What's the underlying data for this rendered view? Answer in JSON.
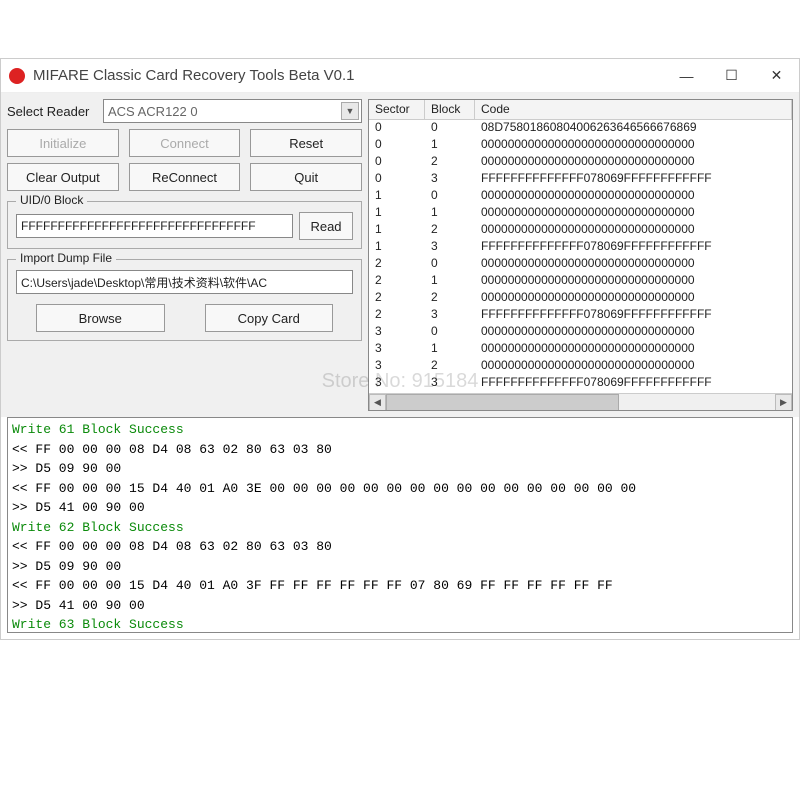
{
  "window": {
    "title": "MIFARE Classic Card Recovery Tools Beta V0.1"
  },
  "labels": {
    "select_reader": "Select Reader",
    "uid_block": "UID/0 Block",
    "import_dump": "Import Dump File"
  },
  "reader": {
    "selected": "ACS ACR122 0"
  },
  "buttons": {
    "initialize": "Initialize",
    "connect": "Connect",
    "reset": "Reset",
    "clear_output": "Clear Output",
    "reconnect": "ReConnect",
    "quit": "Quit",
    "read": "Read",
    "browse": "Browse",
    "copy_card": "Copy Card"
  },
  "uid": {
    "value": "FFFFFFFFFFFFFFFFFFFFFFFFFFFFFFFF"
  },
  "dump": {
    "path": "C:\\Users\\jade\\Desktop\\常用\\技术资料\\软件\\AC"
  },
  "table": {
    "headers": {
      "sector": "Sector",
      "block": "Block",
      "code": "Code"
    },
    "rows": [
      {
        "s": "0",
        "b": "0",
        "c": "08D75801860804006263646566676869"
      },
      {
        "s": "0",
        "b": "1",
        "c": "00000000000000000000000000000000"
      },
      {
        "s": "0",
        "b": "2",
        "c": "00000000000000000000000000000000"
      },
      {
        "s": "0",
        "b": "3",
        "c": "FFFFFFFFFFFFFF078069FFFFFFFFFFFF"
      },
      {
        "s": "1",
        "b": "0",
        "c": "00000000000000000000000000000000"
      },
      {
        "s": "1",
        "b": "1",
        "c": "00000000000000000000000000000000"
      },
      {
        "s": "1",
        "b": "2",
        "c": "00000000000000000000000000000000"
      },
      {
        "s": "1",
        "b": "3",
        "c": "FFFFFFFFFFFFFF078069FFFFFFFFFFFF"
      },
      {
        "s": "2",
        "b": "0",
        "c": "00000000000000000000000000000000"
      },
      {
        "s": "2",
        "b": "1",
        "c": "00000000000000000000000000000000"
      },
      {
        "s": "2",
        "b": "2",
        "c": "00000000000000000000000000000000"
      },
      {
        "s": "2",
        "b": "3",
        "c": "FFFFFFFFFFFFFF078069FFFFFFFFFFFF"
      },
      {
        "s": "3",
        "b": "0",
        "c": "00000000000000000000000000000000"
      },
      {
        "s": "3",
        "b": "1",
        "c": "00000000000000000000000000000000"
      },
      {
        "s": "3",
        "b": "2",
        "c": "00000000000000000000000000000000"
      },
      {
        "s": "3",
        "b": "3",
        "c": "FFFFFFFFFFFFFF078069FFFFFFFFFFFF"
      }
    ]
  },
  "log": [
    {
      "cls": "green",
      "t": "Write 61 Block Success"
    },
    {
      "cls": "black",
      "t": "<< FF 00 00 00 08 D4 08 63 02 80 63 03 80"
    },
    {
      "cls": "black",
      "t": ">> D5 09 90 00"
    },
    {
      "cls": "black",
      "t": "<< FF 00 00 00 15 D4 40 01 A0 3E 00 00 00 00 00 00 00 00 00 00 00 00 00 00 00 00"
    },
    {
      "cls": "black",
      "t": ">> D5 41 00 90 00"
    },
    {
      "cls": "green",
      "t": "Write 62 Block Success"
    },
    {
      "cls": "black",
      "t": "<< FF 00 00 00 08 D4 08 63 02 80 63 03 80"
    },
    {
      "cls": "black",
      "t": ">> D5 09 90 00"
    },
    {
      "cls": "black",
      "t": "<< FF 00 00 00 15 D4 40 01 A0 3F FF FF FF FF FF FF 07 80 69 FF FF FF FF FF FF"
    },
    {
      "cls": "black",
      "t": ">> D5 41 00 90 00"
    },
    {
      "cls": "green",
      "t": "Write 63 Block Success"
    }
  ],
  "watermark": "Store No: 915184"
}
